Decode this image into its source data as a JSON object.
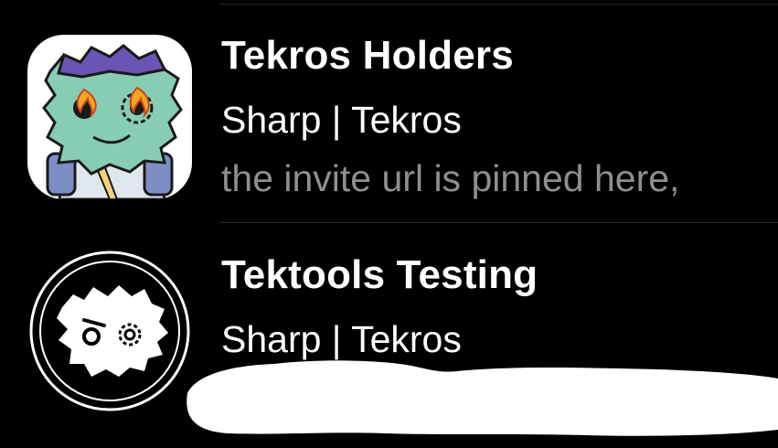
{
  "chat_list": {
    "items": [
      {
        "title": "Tekros Holders",
        "sender": "Sharp | Tekros",
        "preview": "the invite url is pinned here,",
        "avatar_icon": "tekros-character-icon"
      },
      {
        "title": "Tektools Testing",
        "sender": "Sharp | Tekros",
        "preview": "",
        "avatar_icon": "tektools-logo-icon"
      }
    ]
  },
  "colors": {
    "background": "#000000",
    "title": "#ffffff",
    "preview": "#8e8e93",
    "divider": "#2a2a2c"
  }
}
